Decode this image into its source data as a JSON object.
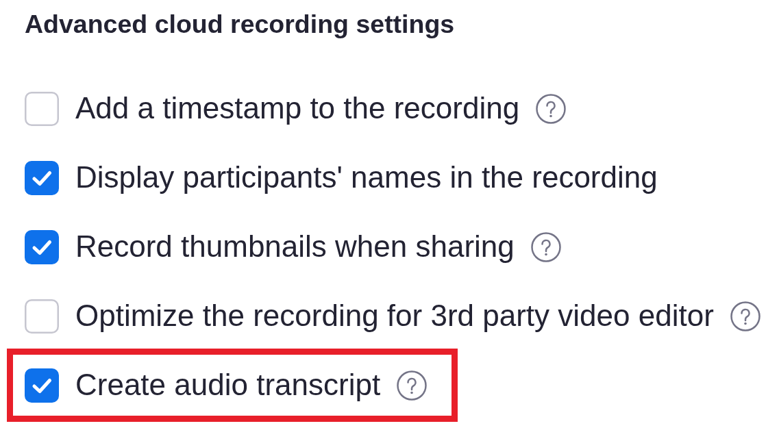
{
  "heading": "Advanced cloud recording settings",
  "options": [
    {
      "label": "Add a timestamp to the recording",
      "checked": false,
      "help": true,
      "highlighted": false
    },
    {
      "label": "Display participants' names in the recording",
      "checked": true,
      "help": false,
      "highlighted": false
    },
    {
      "label": "Record thumbnails when sharing",
      "checked": true,
      "help": true,
      "highlighted": false
    },
    {
      "label": "Optimize the recording for 3rd party video editor",
      "checked": false,
      "help": true,
      "highlighted": false
    },
    {
      "label": "Create audio transcript",
      "checked": true,
      "help": true,
      "highlighted": true
    }
  ]
}
